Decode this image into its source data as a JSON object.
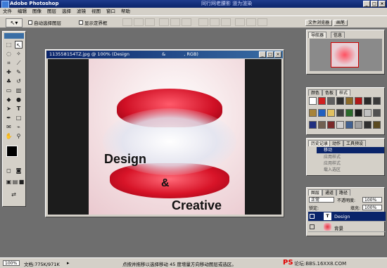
{
  "app": {
    "title": "Adobe Photoshop",
    "overlay_text": "同行网老腰影  道为渲染"
  },
  "menu": [
    "文件",
    "编辑",
    "图像",
    "图层",
    "选择",
    "滤镜",
    "视图",
    "窗口",
    "帮助"
  ],
  "options": {
    "auto_select_layer": "自动选择图层",
    "show_bounding_box": "显示定界框",
    "file_browser_tab": "文件浏览器",
    "brushes_tab": "画笔"
  },
  "document": {
    "title": "113558154TZ.jpg @ 100% (Design",
    "title_suffix": "&",
    "title_mode": ", RGB)",
    "words": {
      "w1": "Design",
      "w2": "&",
      "w3": "Creative"
    }
  },
  "status": {
    "zoom": "100%",
    "doc_size": "文档:775K/971K",
    "hint": "点按并拖移以选择移动 45 度增量方向移动图层或选区。"
  },
  "watermark": {
    "brand": "PS",
    "rest": "论坛:BBS.16XX8.COM"
  },
  "navigator": {
    "tabs": [
      "导航器",
      "信息"
    ]
  },
  "styles": {
    "tabs": [
      "颜色",
      "色板",
      "样式"
    ],
    "colors": [
      "#ffffff",
      "#d02020",
      "#606060",
      "#303030",
      "#8c6a28",
      "#b01818",
      "#2a2a2a",
      "#3a3a3a",
      "#a88438",
      "#2060c0",
      "#e0c060",
      "#404040",
      "#2a6a2a",
      "#1a1a1a",
      "#c0c0c0",
      "#505050",
      "#203080",
      "#706050",
      "#7a2a2a",
      "#d0d0d0",
      "#406090",
      "#a0a0a0",
      "#303030",
      "#5a4a20"
    ]
  },
  "history": {
    "tabs": [
      "历史记录",
      "动作",
      "工具预设"
    ],
    "items": [
      "移动",
      "应用样式",
      "应用样式",
      "载入选区"
    ]
  },
  "layers": {
    "tabs": [
      "图层",
      "通道",
      "路径"
    ],
    "blend_mode": "正常",
    "opacity_label": "不透明度:",
    "opacity_value": "100%",
    "lock_label": "锁定:",
    "fill_label": "填充:",
    "fill_value": "100%",
    "items": [
      {
        "name": "Design",
        "thumb": "T",
        "selected": true
      },
      {
        "name": "背景",
        "thumb": "",
        "selected": false
      }
    ]
  }
}
